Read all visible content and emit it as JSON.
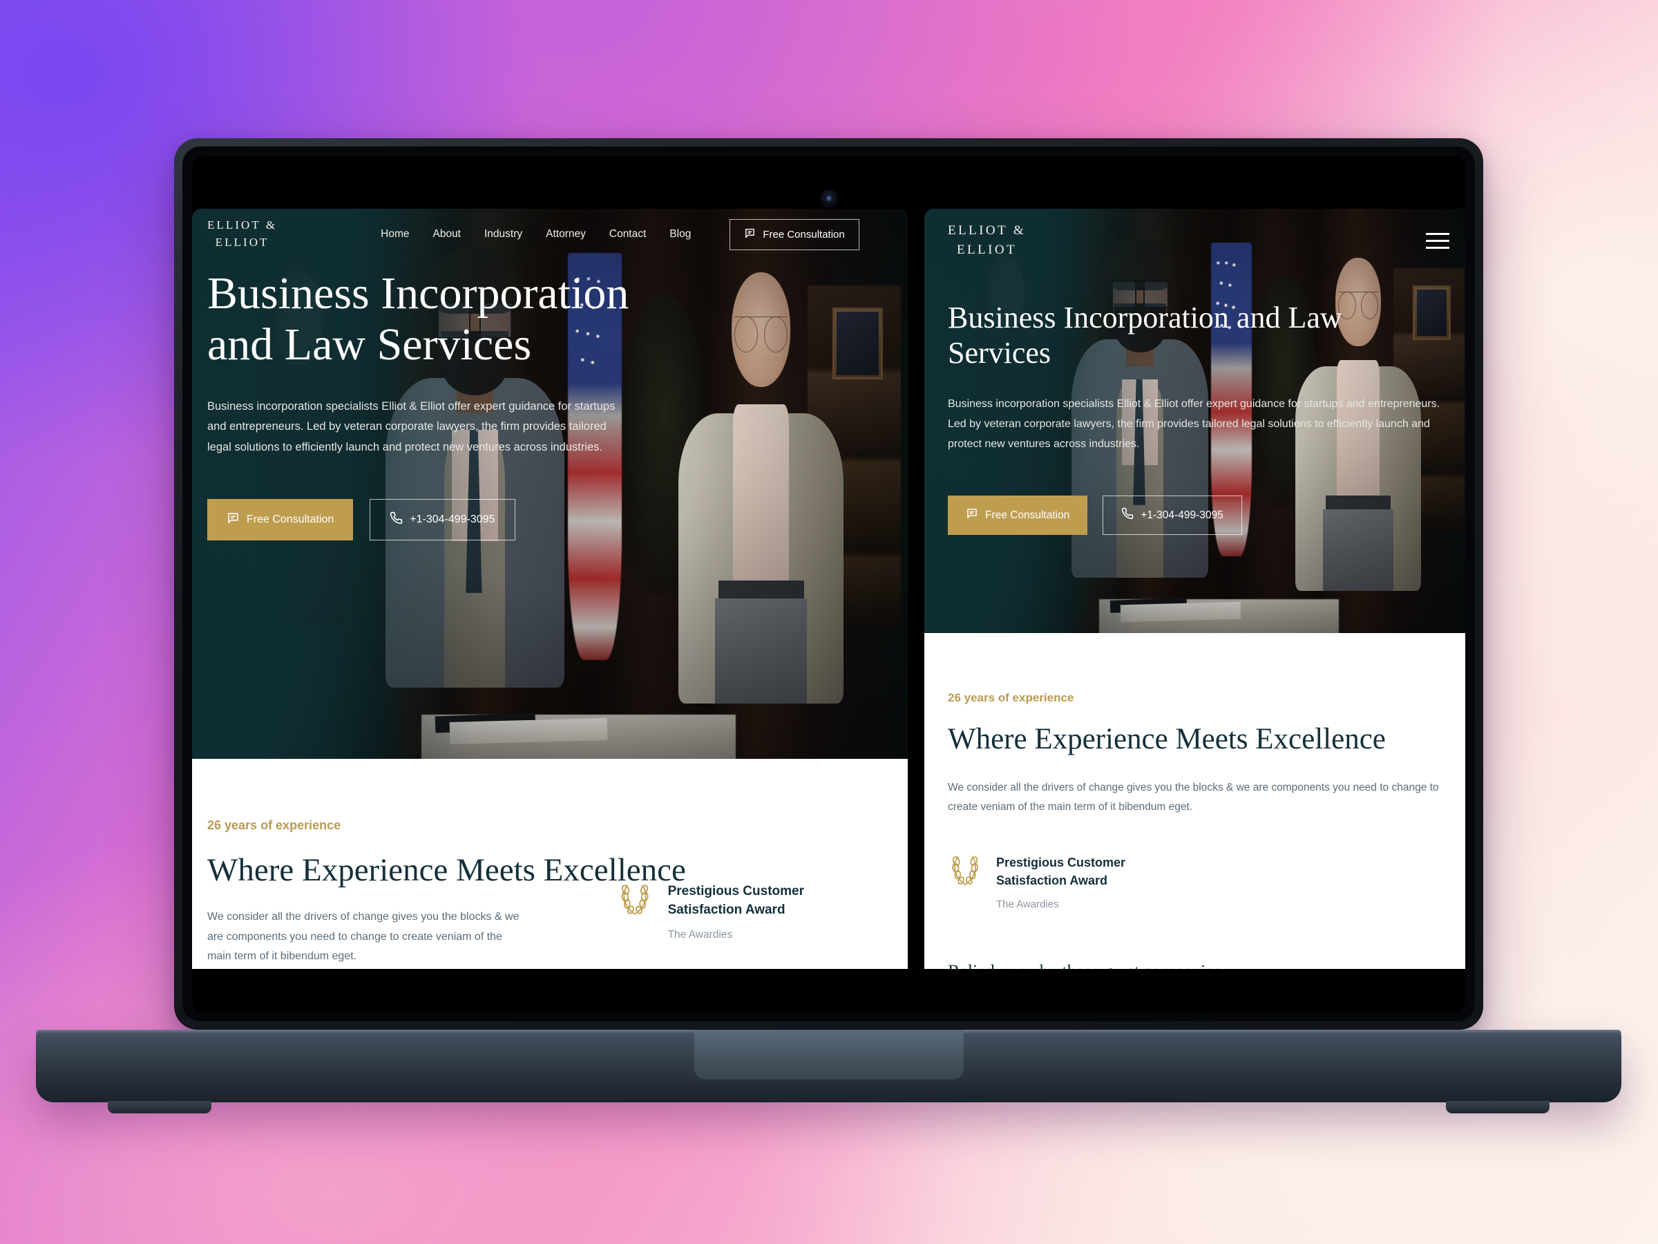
{
  "brand": {
    "line1": "ELLIOT &",
    "line2": "ELLIOT"
  },
  "nav": {
    "items": [
      "Home",
      "About",
      "Industry",
      "Attorney",
      "Contact",
      "Blog"
    ],
    "cta_label": "Free Consultation",
    "cta_icon": "chat-bubble-icon",
    "menu_icon": "hamburger-menu-icon"
  },
  "hero": {
    "desktop_title": "Business Incorporation and Law Services",
    "mobile_title": "Business Incorporation and Law Services",
    "body": "Business incorporation specialists Elliot & Elliot offer expert guidance for startups and entrepreneurs. Led by veteran corporate lawyers, the firm provides tailored legal solutions to efficiently launch and protect new ventures across industries.",
    "cta_primary": "Free Consultation",
    "cta_primary_icon": "chat-bubble-icon",
    "cta_phone": "+1-304-499-3095",
    "cta_phone_icon": "phone-icon"
  },
  "experience": {
    "eyebrow": "26 years of experience",
    "title": "Where Experience Meets Excellence",
    "body": "We consider all the drivers of change gives you the blocks & we are components you need to change to create veniam of the main term of it bibendum eget.",
    "relied_heading": "Relied upon by these great companies"
  },
  "award": {
    "icon": "laurel-wreath-icon",
    "title_line1": "Prestigious Customer",
    "title_line2": "Satisfaction Award",
    "org": "The Awardies"
  },
  "colors": {
    "brand_teal": "#0f2f33",
    "gold": "#bf9d4e",
    "eyebrow_gold": "#b99b52",
    "ink": "#14303a",
    "body_gray": "#5b6b78",
    "muted_gray": "#8b95a0"
  }
}
